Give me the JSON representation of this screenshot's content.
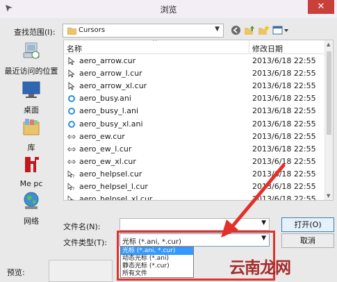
{
  "window": {
    "title": "浏览"
  },
  "lookin": {
    "label": "查找范围(I):",
    "folder": "Cursors"
  },
  "places": [
    {
      "label": "最近访问的位置"
    },
    {
      "label": "桌面"
    },
    {
      "label": "库"
    },
    {
      "label": "Me pc"
    },
    {
      "label": "网络"
    }
  ],
  "filelist": {
    "col_name": "名称",
    "col_date": "修改日期",
    "rows": [
      {
        "name": "aero_arrow.cur",
        "date": "2013/6/18 22:55",
        "icon": "arrow-cursor-icon"
      },
      {
        "name": "aero_arrow_l.cur",
        "date": "2013/6/18 22:55",
        "icon": "arrow-cursor-icon"
      },
      {
        "name": "aero_arrow_xl.cur",
        "date": "2013/6/18 22:55",
        "icon": "arrow-cursor-icon"
      },
      {
        "name": "aero_busy.ani",
        "date": "2013/6/18 22:55",
        "icon": "busy-ring-icon"
      },
      {
        "name": "aero_busy_l.ani",
        "date": "2013/6/18 22:55",
        "icon": "busy-ring-icon"
      },
      {
        "name": "aero_busy_xl.ani",
        "date": "2013/6/18 22:55",
        "icon": "busy-ring-icon"
      },
      {
        "name": "aero_ew.cur",
        "date": "2013/6/18 22:55",
        "icon": "resize-ew-icon"
      },
      {
        "name": "aero_ew_l.cur",
        "date": "2013/6/18 22:55",
        "icon": "resize-ew-icon"
      },
      {
        "name": "aero_ew_xl.cur",
        "date": "2013/6/18 22:55",
        "icon": "resize-ew-icon"
      },
      {
        "name": "aero_helpsel.cur",
        "date": "2013/6/18 22:55",
        "icon": "help-cursor-icon"
      },
      {
        "name": "aero_helpsel_l.cur",
        "date": "2013/6/18 22:55",
        "icon": "help-cursor-icon"
      },
      {
        "name": "aero_helpsel_xl.cur",
        "date": "2013/6/18 22:55",
        "icon": "help-cursor-icon"
      }
    ]
  },
  "filename": {
    "label": "文件名(N):",
    "value": ""
  },
  "filetype": {
    "label": "文件类型(T):",
    "value": "光标 (*.ani, *.cur)",
    "options": [
      "光标 (*.ani, *.cur)",
      "动态光标 (*.ani)",
      "静态光标 (*.cur)",
      "所有文件"
    ]
  },
  "buttons": {
    "open": "打开(O)",
    "cancel": "取消"
  },
  "preview": {
    "label": "预览:"
  },
  "watermark": "云南龙网",
  "colors": {
    "highlight": "#e2302b",
    "selection": "#3399ff"
  }
}
